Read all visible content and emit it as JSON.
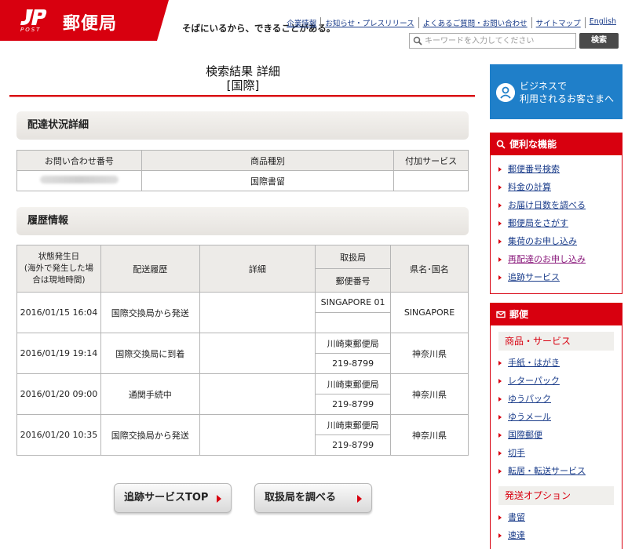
{
  "header": {
    "logo_name": "郵便局",
    "logo_post": "POST",
    "tagline": "そばにいるから、できることがある。",
    "links": [
      "企業情報",
      "お知らせ・プレスリリース",
      "よくあるご質問・お問い合わせ",
      "サイトマップ",
      "English"
    ],
    "search_placeholder": "キーワードを入力してください",
    "search_button": "検索"
  },
  "main": {
    "title_line1": "検索結果 詳細",
    "title_line2": "[国際]",
    "section1": "配達状況詳細",
    "summary_headers": [
      "お問い合わせ番号",
      "商品種別",
      "付加サービス"
    ],
    "summary_row": {
      "tracking_number": "",
      "product_type": "国際書留",
      "extra_service": ""
    },
    "section2": "履歴情報",
    "history_headers": {
      "date": "状態発生日\n(海外で発生した場合は現地時間)",
      "status": "配送履歴",
      "detail": "詳細",
      "office": "取扱局",
      "postal": "郵便番号",
      "region": "県名･国名"
    },
    "history": [
      {
        "date": "2016/01/15 16:04",
        "status": "国際交換局から発送",
        "detail": "",
        "office": "SINGAPORE 01",
        "postal": "",
        "region": "SINGAPORE"
      },
      {
        "date": "2016/01/19 19:14",
        "status": "国際交換局に到着",
        "detail": "",
        "office": "川崎東郵便局",
        "postal": "219-8799",
        "region": "神奈川県"
      },
      {
        "date": "2016/01/20 09:00",
        "status": "通関手続中",
        "detail": "",
        "office": "川崎東郵便局",
        "postal": "219-8799",
        "region": "神奈川県"
      },
      {
        "date": "2016/01/20 10:35",
        "status": "国際交換局から発送",
        "detail": "",
        "office": "川崎東郵便局",
        "postal": "219-8799",
        "region": "神奈川県"
      }
    ],
    "button_top": "追跡サービスTOP",
    "button_office": "取扱局を調べる"
  },
  "sidebar": {
    "business": "ビジネスで\n利用されるお客さまへ",
    "useful_title": "便利な機能",
    "useful_items": [
      "郵便番号検索",
      "料金の計算",
      "お届け日数を調べる",
      "郵便局をさがす",
      "集荷のお申し込み",
      "再配達のお申し込み",
      "追跡サービス"
    ],
    "mail_title": "郵便",
    "products_title": "商品・サービス",
    "product_items": [
      "手紙・はがき",
      "レターパック",
      "ゆうパック",
      "ゆうメール",
      "国際郵便",
      "切手",
      "転居・転送サービス"
    ],
    "options_title": "発送オプション",
    "option_items": [
      "書留",
      "速達"
    ]
  },
  "colors": {
    "brand_red": "#d8000f",
    "business_blue": "#1f7fc9",
    "link_blue": "#1a3c8a"
  }
}
